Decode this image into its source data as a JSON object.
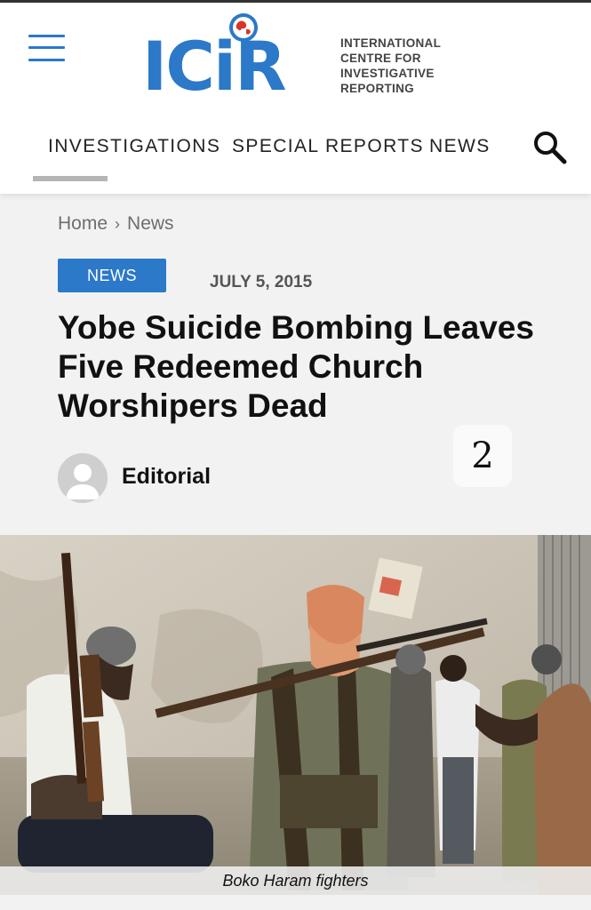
{
  "site": {
    "logo_text": "ICiR",
    "logo_subtitle": [
      "INTERNATIONAL",
      "CENTRE FOR",
      "INVESTIGATIVE",
      "REPORTING"
    ]
  },
  "nav": {
    "items": [
      {
        "label": "INVESTIGATIONS",
        "active": true
      },
      {
        "label": "SPECIAL REPORTS",
        "active": false
      },
      {
        "label": "NEWS",
        "active": false
      }
    ]
  },
  "breadcrumb": {
    "home": "Home",
    "separator": "›",
    "current": "News"
  },
  "article": {
    "category": "NEWS",
    "date": "JULY 5, 2015",
    "title": "Yobe Suicide Bombing Leaves Five Redeemed Church Worshipers Dead",
    "author": "Editorial",
    "image_caption": "Boko Haram fighters"
  },
  "overlay": {
    "page_marker": "2"
  },
  "colors": {
    "brand_blue": "#2b79c8",
    "logo_red": "#d9342b",
    "background": "#f2f2f2",
    "header_bg": "#ffffff"
  },
  "icons": [
    "hamburger-menu-icon",
    "globe-icon",
    "search-icon",
    "avatar-placeholder-icon"
  ]
}
